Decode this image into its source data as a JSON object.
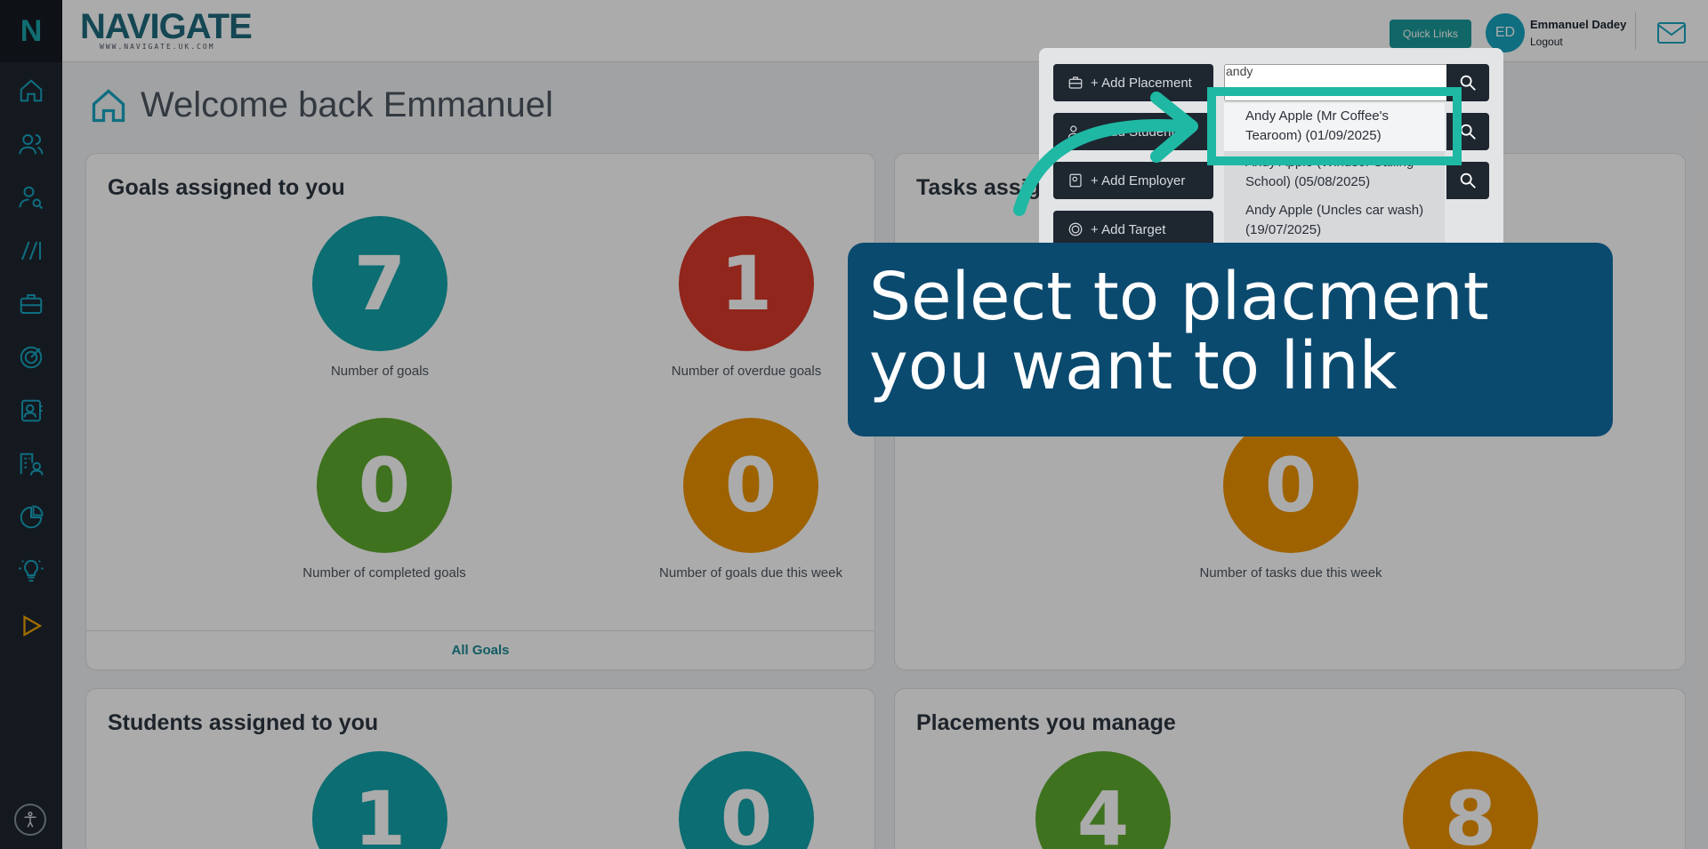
{
  "app": {
    "brand": "NAVIGATE",
    "brand_sub": "WWW.NAVIGATE.UK.COM",
    "logo_letter": "N"
  },
  "header": {
    "quick_links": "Quick Links",
    "avatar_initials": "ED",
    "user_name": "Emmanuel Dadey",
    "logout": "Logout"
  },
  "sidebar": {
    "items": [
      {
        "icon": "home-icon"
      },
      {
        "icon": "users-icon"
      },
      {
        "icon": "user-search-icon"
      },
      {
        "icon": "slashes-icon"
      },
      {
        "icon": "briefcase-icon"
      },
      {
        "icon": "target-icon"
      },
      {
        "icon": "contact-card-icon"
      },
      {
        "icon": "building-user-icon"
      },
      {
        "icon": "pie-chart-icon"
      },
      {
        "icon": "lightbulb-icon"
      },
      {
        "icon": "play-icon"
      }
    ]
  },
  "page": {
    "title": "Welcome back Emmanuel"
  },
  "goals_card": {
    "title": "Goals assigned to you",
    "stats": [
      {
        "value": "7",
        "label": "Number of goals"
      },
      {
        "value": "1",
        "label": "Number of overdue goals"
      },
      {
        "value": "0",
        "label": "Number of completed goals"
      },
      {
        "value": "0",
        "label": "Number of goals due this week"
      }
    ],
    "footer": "All Goals"
  },
  "tasks_card": {
    "title": "Tasks assig",
    "stats": [
      {
        "value": "0",
        "label": "Number of tasks due this week"
      }
    ]
  },
  "students_card": {
    "title": "Students assigned to you",
    "stats": [
      {
        "value": "1"
      },
      {
        "value": "0"
      }
    ]
  },
  "placements_card": {
    "title": "Placements you manage",
    "stats": [
      {
        "value": "4"
      },
      {
        "value": "8"
      }
    ]
  },
  "quick_panel": {
    "buttons": [
      {
        "label": "+ Add Placement"
      },
      {
        "label": "+ Add Student"
      },
      {
        "label": "+ Add Employer"
      },
      {
        "label": "+ Add Target"
      }
    ],
    "search_value": "andy"
  },
  "suggestions": [
    "Andy Apple (Mr Coffee's Tearoom) (01/09/2025)",
    "Andy Apple (Windsor Sailing School) (05/08/2025)",
    "Andy Apple (Uncles car wash) (19/07/2025)"
  ],
  "callout": {
    "text": "Select to placment you want to link"
  },
  "colors": {
    "sidebar": "#1e2630",
    "teal": "#12a3aa",
    "red": "#d9392b",
    "green": "#5eaa2e",
    "orange": "#ec9300",
    "callout": "#0b4a6f",
    "highlight": "#1fb8a4"
  }
}
